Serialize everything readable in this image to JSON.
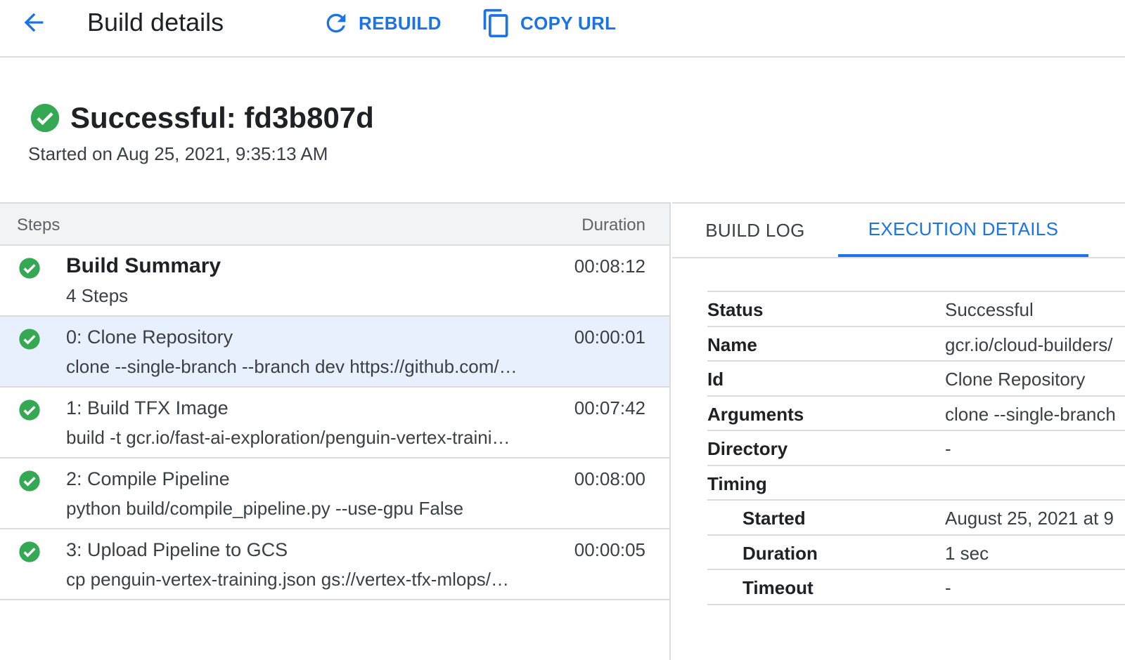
{
  "topbar": {
    "back_icon": "arrow-back-icon",
    "title": "Build details",
    "rebuild_label": "REBUILD",
    "rebuild_icon": "refresh-icon",
    "copy_url_label": "COPY URL",
    "copy_icon": "copy-icon"
  },
  "header": {
    "status_icon": "check-circle-icon",
    "title": "Successful: fd3b807d",
    "started": "Started on Aug 25, 2021, 9:35:13 AM"
  },
  "steps": {
    "header_steps": "Steps",
    "header_duration": "Duration",
    "summary": {
      "title": "Build Summary",
      "subtitle": "4 Steps",
      "duration": "00:08:12"
    },
    "items": [
      {
        "title": "0: Clone Repository",
        "command": "clone --single-branch --branch dev https://github.com/…",
        "duration": "00:00:01"
      },
      {
        "title": "1: Build TFX Image",
        "command": "build -t gcr.io/fast-ai-exploration/penguin-vertex-traini…",
        "duration": "00:07:42"
      },
      {
        "title": "2: Compile Pipeline",
        "command": "python build/compile_pipeline.py --use-gpu False",
        "duration": "00:08:00"
      },
      {
        "title": "3: Upload Pipeline to GCS",
        "command": "cp penguin-vertex-training.json gs://vertex-tfx-mlops/…",
        "duration": "00:00:05"
      }
    ]
  },
  "tabs": {
    "build_log": "BUILD LOG",
    "execution_details": "EXECUTION DETAILS"
  },
  "details": {
    "status_label": "Status",
    "status_value": "Successful",
    "name_label": "Name",
    "name_value": "gcr.io/cloud-builders/",
    "id_label": "Id",
    "id_value": "Clone Repository",
    "arguments_label": "Arguments",
    "arguments_value": "clone --single-branch",
    "directory_label": "Directory",
    "directory_value": "-",
    "timing_label": "Timing",
    "started_label": "Started",
    "started_value": "August 25, 2021 at 9",
    "duration_label": "Duration",
    "duration_value": "1 sec",
    "timeout_label": "Timeout",
    "timeout_value": "-"
  },
  "colors": {
    "accent": "#1a73e8",
    "success": "#34a853",
    "selected_row": "#e8f0fe",
    "divider": "#dadce0"
  }
}
